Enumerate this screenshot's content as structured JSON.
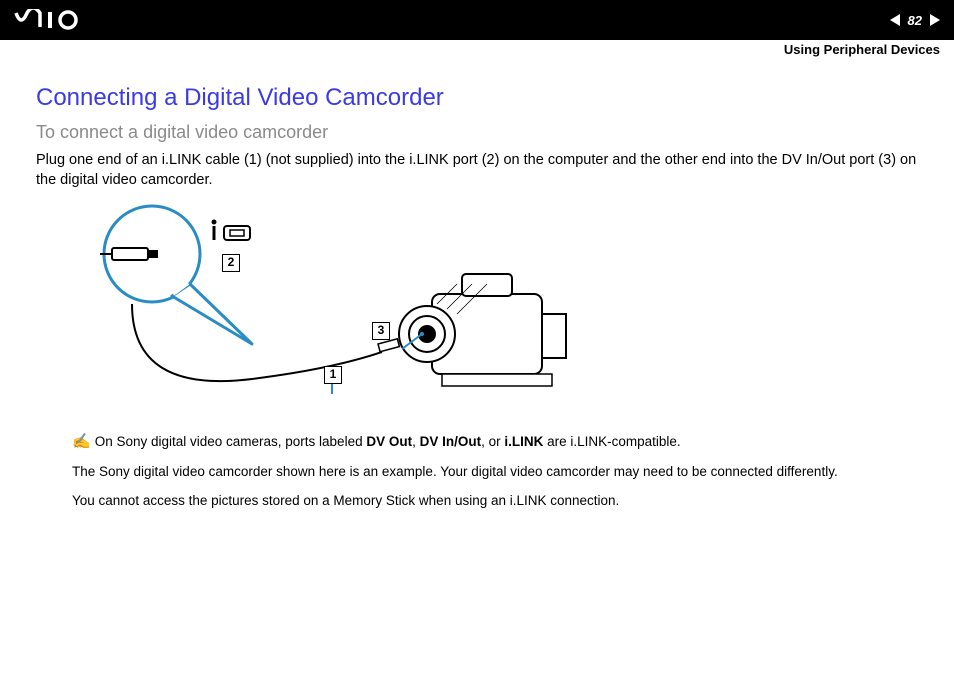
{
  "header": {
    "page_number": "82",
    "section_title": "Using Peripheral Devices"
  },
  "heading_main": "Connecting a Digital Video Camcorder",
  "heading_sub": "To connect a digital video camcorder",
  "body_paragraph": "Plug one end of an i.LINK cable (1) (not supplied) into the i.LINK port (2) on the computer and the other end into the DV In/Out port (3) on the digital video camcorder.",
  "figure": {
    "callout_1": "1",
    "callout_2": "2",
    "callout_3": "3"
  },
  "notes": {
    "line1_pre": "On Sony digital video cameras, ports labeled ",
    "line1_b1": "DV Out",
    "line1_s1": ", ",
    "line1_b2": "DV In/Out",
    "line1_s2": ", or ",
    "line1_b3": "i.LINK",
    "line1_post": " are i.LINK-compatible.",
    "line2": "The Sony digital video camcorder shown here is an example. Your digital video camcorder may need to be connected differently.",
    "line3": "You cannot access the pictures stored on a Memory Stick when using an i.LINK connection."
  }
}
